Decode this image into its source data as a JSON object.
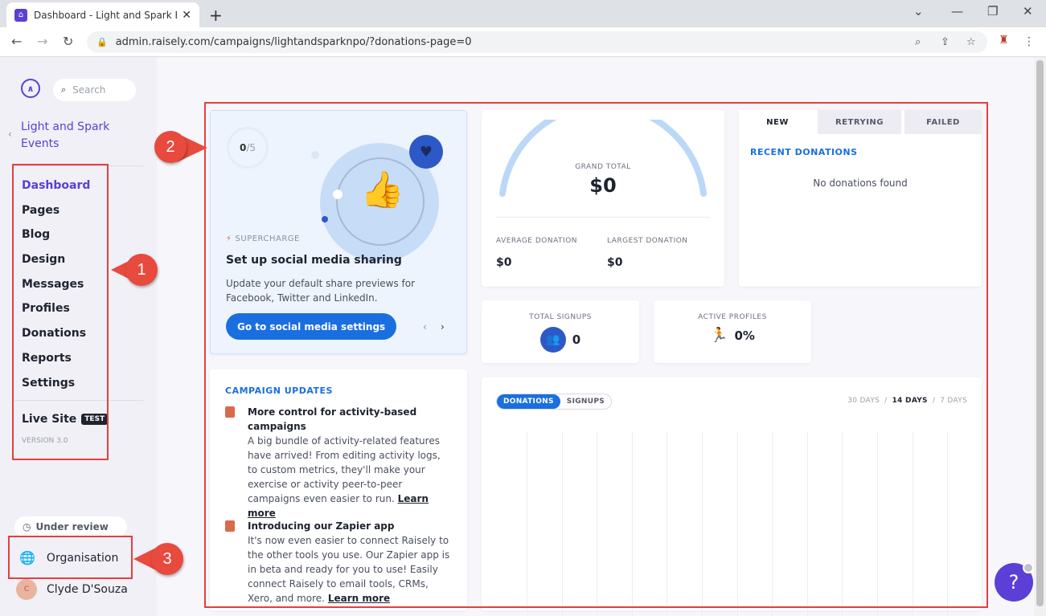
{
  "browser": {
    "tab_title": "Dashboard - Light and Spark Eve",
    "url": "admin.raisely.com/campaigns/lightandsparknpo/?donations-page=0"
  },
  "sidebar": {
    "search_placeholder": "Search",
    "campaign_name": "Light and Spark Events",
    "items": [
      {
        "label": "Dashboard"
      },
      {
        "label": "Pages"
      },
      {
        "label": "Blog"
      },
      {
        "label": "Design"
      },
      {
        "label": "Messages"
      },
      {
        "label": "Profiles"
      },
      {
        "label": "Donations"
      },
      {
        "label": "Reports"
      },
      {
        "label": "Settings"
      }
    ],
    "live_site": "Live Site",
    "live_badge": "TEST",
    "version": "VERSION 3.0",
    "under_review": "Under review",
    "organisation": "Organisation",
    "user_name": "Clyde D'Souza",
    "user_initial": "C"
  },
  "promo": {
    "progress_done": "0",
    "progress_total": "/5",
    "eyebrow": "SUPERCHARGE",
    "title": "Set up social media sharing",
    "body": "Update your default share previews for Facebook, Twitter and LinkedIn.",
    "cta": "Go to social media settings"
  },
  "totals": {
    "grand_total_label": "GRAND TOTAL",
    "grand_total": "$0",
    "avg_label": "AVERAGE DONATION",
    "avg_value": "$0",
    "largest_label": "LARGEST DONATION",
    "largest_value": "$0"
  },
  "donations_panel": {
    "tabs": [
      "NEW",
      "RETRYING",
      "FAILED"
    ],
    "recent_title": "RECENT DONATIONS",
    "empty_text": "No donations found"
  },
  "signups": {
    "label": "TOTAL SIGNUPS",
    "value": "0"
  },
  "profiles": {
    "label": "ACTIVE PROFILES",
    "value": "0%"
  },
  "updates": {
    "title": "CAMPAIGN UPDATES",
    "items": [
      {
        "title": "More control for activity-based campaigns",
        "body": "A big bundle of activity-related features have arrived! From editing activity logs, to custom metrics, they'll make your exercise or activity peer-to-peer campaigns even easier to run.",
        "link": "Learn more"
      },
      {
        "title": "Introducing our Zapier app",
        "body": "It's now even easier to connect Raisely to the other tools you use. Our Zapier app is in beta and ready for you to use! Easily connect Raisely to email tools, CRMs, Xero, and more.",
        "link": "Learn more"
      }
    ]
  },
  "chart_panel": {
    "toggle_on": "DONATIONS",
    "toggle_off": "SIGNUPS",
    "ranges": [
      "30 DAYS",
      "14 DAYS",
      "7 DAYS"
    ],
    "active_range": "14 DAYS"
  },
  "callouts": [
    "1",
    "2",
    "3"
  ],
  "help_label": "?",
  "colors": {
    "brand": "#5b3fd6",
    "accent": "#1a6fe0",
    "annotation": "#e43f3f"
  }
}
